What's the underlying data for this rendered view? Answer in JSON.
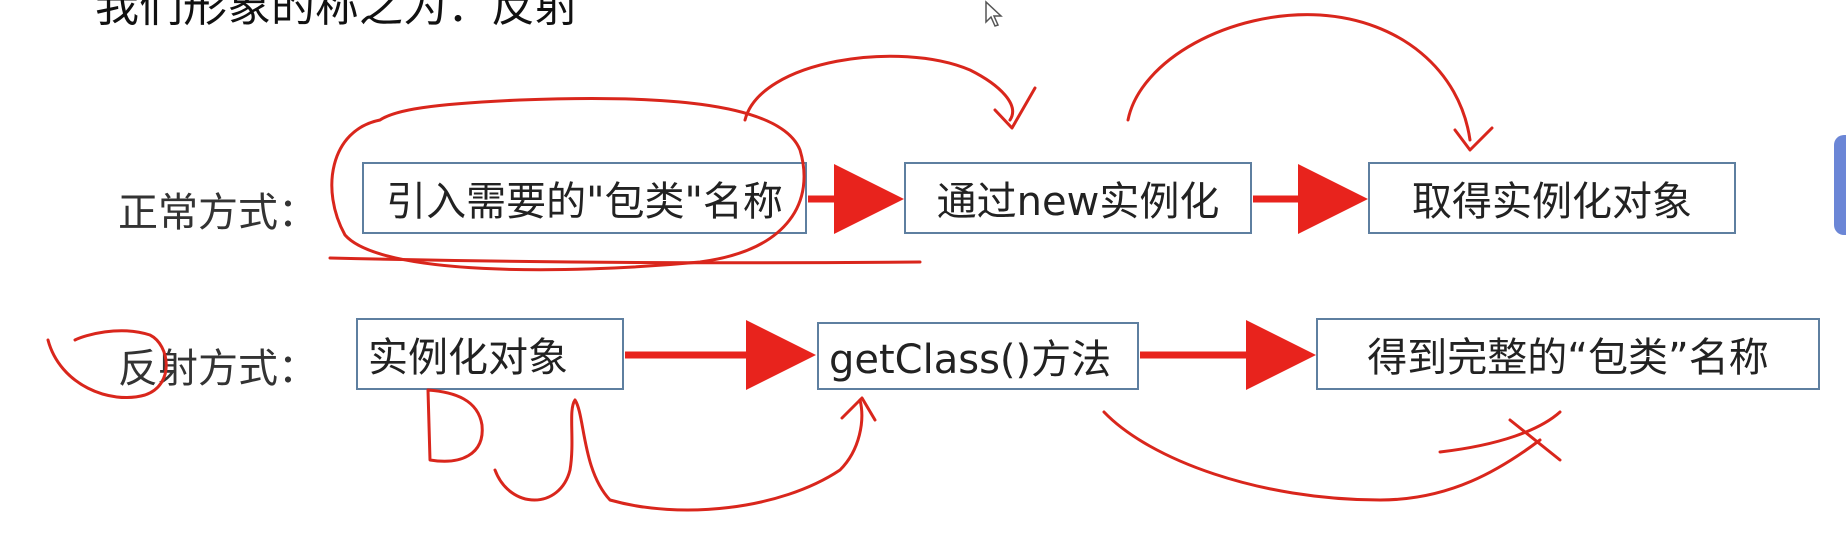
{
  "title": "我们形象的称之为：反射",
  "rows": {
    "normal": {
      "label": "正常方式：",
      "steps": [
        "引入需要的\"包类\"名称",
        "通过new实例化",
        "取得实例化对象"
      ]
    },
    "reflect": {
      "label": "反射方式：",
      "steps": [
        "实例化对象",
        "getClass()方法",
        "得到完整的“包类”名称"
      ]
    }
  },
  "colors": {
    "arrow": "#e8231d",
    "box_border": "#5e7fa0",
    "annotation": "#d9261c",
    "side_tab": "#6b86d6"
  },
  "icons": [
    "cursor-icon"
  ]
}
